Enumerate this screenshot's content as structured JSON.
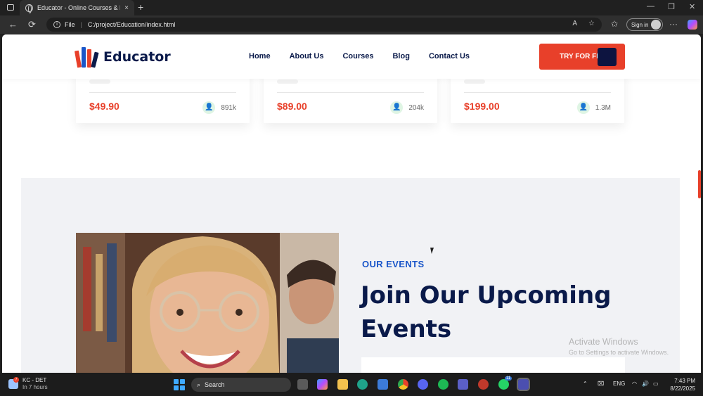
{
  "browser": {
    "tab_title": "Educator - Online Courses & Edu",
    "tab_close": "×",
    "new_tab": "+",
    "url_scheme": "File",
    "url": "C:/project/Education/index.html",
    "signin_label": "Sign in",
    "window_controls": [
      "—",
      "❐",
      "✕"
    ],
    "nav": {
      "back": "←",
      "reload": "⟳",
      "more": "···"
    }
  },
  "site": {
    "brand": "Educator",
    "menu": [
      "Home",
      "About Us",
      "Courses",
      "Blog",
      "Contact Us"
    ],
    "cta": "TRY FOR FREE",
    "accent_color": "#e8402a",
    "navy_color": "#0a1a4a"
  },
  "courses": [
    {
      "price": "$49.90",
      "students": "891k"
    },
    {
      "price": "$89.00",
      "students": "204k"
    },
    {
      "price": "$199.00",
      "students": "1.3M"
    }
  ],
  "events": {
    "eyebrow": "OUR EVENTS",
    "heading": "Join Our Upcoming Events",
    "eyebrow_color": "#1a56c9"
  },
  "watermark": {
    "title": "Activate Windows",
    "subtitle": "Go to Settings to activate Windows."
  },
  "taskbar": {
    "weather_title": "KC - DET",
    "weather_sub": "In 7 hours",
    "weather_badge": "7",
    "search_label": "Search",
    "language": "ENG",
    "time": "7:43 PM",
    "date": "8/22/2025",
    "whatsapp_badge": "11"
  }
}
